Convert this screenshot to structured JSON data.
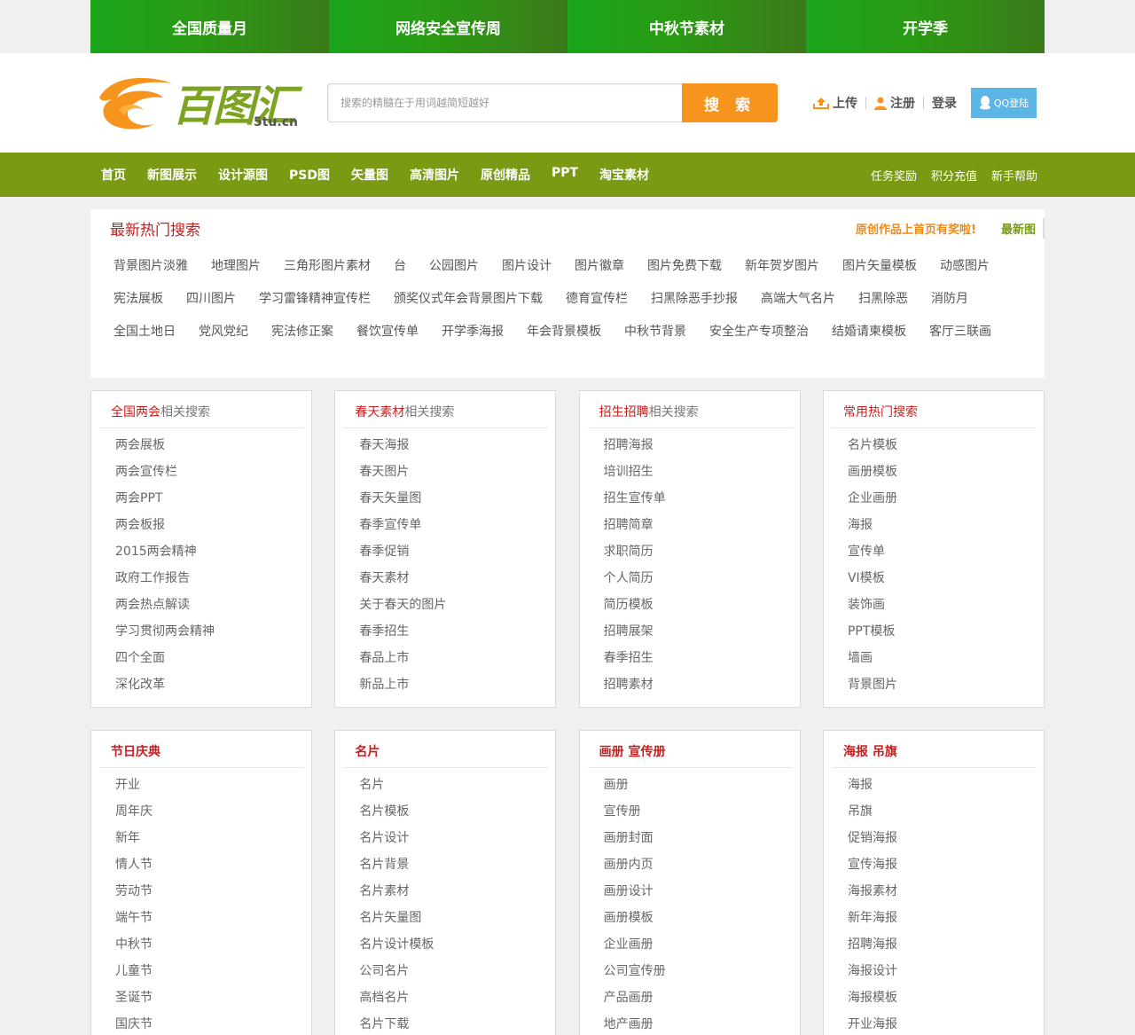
{
  "promo": [
    "全国质量月",
    "网络安全宣传周",
    "中秋节素材",
    "开学季"
  ],
  "logo": {
    "text": "百图汇",
    "domain": "5tu.cn"
  },
  "search": {
    "placeholder": "搜索的精髓在于用词越简短越好",
    "button": "搜 索"
  },
  "user": {
    "upload": "上传",
    "register": "注册",
    "login": "登录",
    "qq": "QQ登陆"
  },
  "nav": {
    "left": [
      "首页",
      "新图展示",
      "设计源图",
      "PSD图",
      "矢量图",
      "高清图片",
      "原创精品",
      "PPT",
      "淘宝素材"
    ],
    "right": [
      "任务奖励",
      "积分充值",
      "新手帮助"
    ]
  },
  "hot": {
    "title": "最新热门搜索",
    "award": "原创作品上首页有奖啦!",
    "latest": "最新图",
    "tags": [
      "背景图片淡雅",
      "地理图片",
      "三角形图片素材",
      "台",
      "公园图片",
      "图片设计",
      "图片徽章",
      "图片免费下载",
      "新年贺岁图片",
      "图片矢量模板",
      "动感图片",
      "宪法展板",
      "四川图片",
      "学习雷锋精神宣传栏",
      "颁奖仪式年会背景图片下载",
      "德育宣传栏",
      "扫黑除恶手抄报",
      "高端大气名片",
      "扫黑除恶",
      "消防月",
      "全国土地日",
      "党风党纪",
      "宪法修正案",
      "餐饮宣传单",
      "开学季海报",
      "年会背景模板",
      "中秋节背景",
      "安全生产专项整治",
      "结婚请柬模板",
      "客厅三联画"
    ]
  },
  "boxes1": [
    {
      "kw": "全国两会",
      "rest": "相关搜索",
      "items": [
        "两会展板",
        "两会宣传栏",
        "两会PPT",
        "两会板报",
        "2015两会精神",
        "政府工作报告",
        "两会热点解读",
        "学习贯彻两会精神",
        "四个全面",
        "深化改革"
      ]
    },
    {
      "kw": "春天素材",
      "rest": "相关搜索",
      "items": [
        "春天海报",
        "春天图片",
        "春天矢量图",
        "春季宣传单",
        "春季促销",
        "春天素材",
        "关于春天的图片",
        "春季招生",
        "春品上市",
        "新品上市"
      ]
    },
    {
      "kw": "招生招聘",
      "rest": "相关搜索",
      "items": [
        "招聘海报",
        "培训招生",
        "招生宣传单",
        "招聘简章",
        "求职简历",
        "个人简历",
        "简历模板",
        "招聘展架",
        "春季招生",
        "招聘素材"
      ]
    },
    {
      "kw": "常用热门搜索",
      "rest": "",
      "items": [
        "名片模板",
        "画册模板",
        "企业画册",
        "海报",
        "宣传单",
        "VI模板",
        "装饰画",
        "PPT模板",
        "墙画",
        "背景图片"
      ]
    }
  ],
  "boxes2": [
    {
      "kw": "节日庆典",
      "rest": "",
      "items": [
        "开业",
        "周年庆",
        "新年",
        "情人节",
        "劳动节",
        "端午节",
        "中秋节",
        "儿童节",
        "圣诞节",
        "国庆节"
      ]
    },
    {
      "kw": "名片",
      "rest": "",
      "items": [
        "名片",
        "名片模板",
        "名片设计",
        "名片背景",
        "名片素材",
        "名片矢量图",
        "名片设计模板",
        "公司名片",
        "高档名片",
        "名片下载"
      ]
    },
    {
      "kw": "画册 宣传册",
      "rest": "",
      "items": [
        "画册",
        "宣传册",
        "画册封面",
        "画册内页",
        "画册设计",
        "画册模板",
        "企业画册",
        "公司宣传册",
        "产品画册",
        "地产画册"
      ]
    },
    {
      "kw": "海报 吊旗",
      "rest": "",
      "items": [
        "海报",
        "吊旗",
        "促销海报",
        "宣传海报",
        "海报素材",
        "新年海报",
        "招聘海报",
        "海报设计",
        "海报模板",
        "开业海报"
      ]
    }
  ],
  "colors": {
    "green_nav": "#7a9a14",
    "orange": "#f7941d",
    "red": "#c81e1e",
    "qq": "#5cb6e5"
  }
}
